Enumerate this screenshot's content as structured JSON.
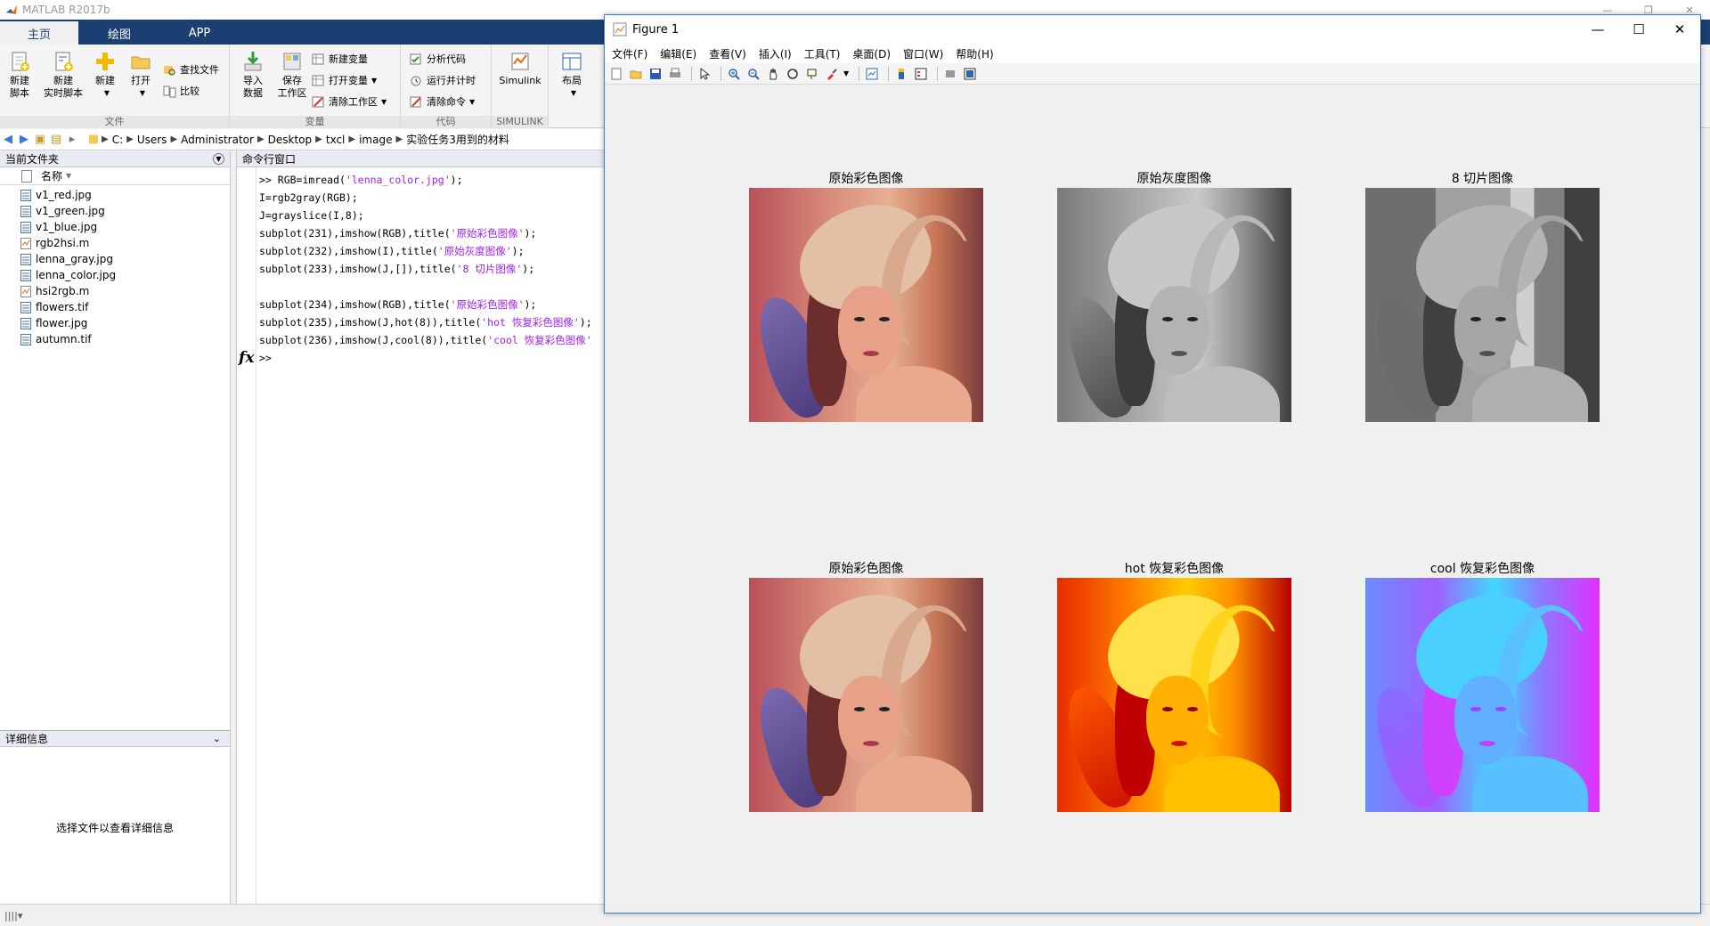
{
  "matlab": {
    "title": "MATLAB R2017b",
    "tabs": [
      "主页",
      "绘图",
      "APP"
    ],
    "ribbon": {
      "file_group": "文件",
      "variable_group": "变量",
      "code_group": "代码",
      "simulink_group": "SIMULINK",
      "new_script": "新建\n脚本",
      "new_live_script": "新建\n实时脚本",
      "new": "新建",
      "open": "打开",
      "find_files": "查找文件",
      "compare": "比较",
      "import_data": "导入\n数据",
      "save_workspace": "保存\n工作区",
      "new_variable": "新建变量",
      "open_variable": "打开变量",
      "clear_workspace": "清除工作区",
      "analyze_code": "分析代码",
      "run_and_time": "运行并计时",
      "clear_commands": "清除命令",
      "simulink": "Simulink",
      "layout": "布局"
    },
    "path": [
      "C:",
      "Users",
      "Administrator",
      "Desktop",
      "txcl",
      "image",
      "实验任务3用到的材料"
    ],
    "current_folder": {
      "title": "当前文件夹",
      "column": "名称",
      "files": [
        "v1_red.jpg",
        "v1_green.jpg",
        "v1_blue.jpg",
        "rgb2hsi.m",
        "lenna_gray.jpg",
        "lenna_color.jpg",
        "hsi2rgb.m",
        "flowers.tif",
        "flower.jpg",
        "autumn.tif"
      ]
    },
    "details": {
      "title": "详细信息",
      "message": "选择文件以查看详细信息"
    },
    "command_window": {
      "title": "命令行窗口",
      "lines": [
        {
          "pre": ">> RGB=imread(",
          "str": "'lenna_color.jpg'",
          "post": ");"
        },
        {
          "pre": "I=rgb2gray(RGB);",
          "str": "",
          "post": ""
        },
        {
          "pre": "J=grayslice(I,8);",
          "str": "",
          "post": ""
        },
        {
          "pre": "subplot(231),imshow(RGB),title(",
          "str": "'原始彩色图像'",
          "post": ");"
        },
        {
          "pre": "subplot(232),imshow(I),title(",
          "str": "'原始灰度图像'",
          "post": ");"
        },
        {
          "pre": "subplot(233),imshow(J,[]),title(",
          "str": "'8 切片图像'",
          "post": ");"
        },
        {
          "pre": "",
          "str": "",
          "post": ""
        },
        {
          "pre": "subplot(234),imshow(RGB),title(",
          "str": "'原始彩色图像'",
          "post": ");"
        },
        {
          "pre": "subplot(235),imshow(J,hot(8)),title(",
          "str": "'hot 恢复彩色图像'",
          "post": ");"
        },
        {
          "pre": "subplot(236),imshow(J,cool(8)),title(",
          "str": "'cool 恢复彩色图像'",
          "post": ""
        }
      ],
      "prompt": ">>"
    }
  },
  "figure": {
    "title": "Figure 1",
    "menu": [
      "文件(F)",
      "编辑(E)",
      "查看(V)",
      "插入(I)",
      "工具(T)",
      "桌面(D)",
      "窗口(W)",
      "帮助(H)"
    ],
    "subplots": [
      {
        "title": "原始彩色图像",
        "variant": "color"
      },
      {
        "title": "原始灰度图像",
        "variant": "gray"
      },
      {
        "title": "8 切片图像",
        "variant": "slice"
      },
      {
        "title": "原始彩色图像",
        "variant": "color"
      },
      {
        "title": "hot 恢复彩色图像",
        "variant": "hot"
      },
      {
        "title": "cool 恢复彩色图像",
        "variant": "cool"
      }
    ]
  }
}
